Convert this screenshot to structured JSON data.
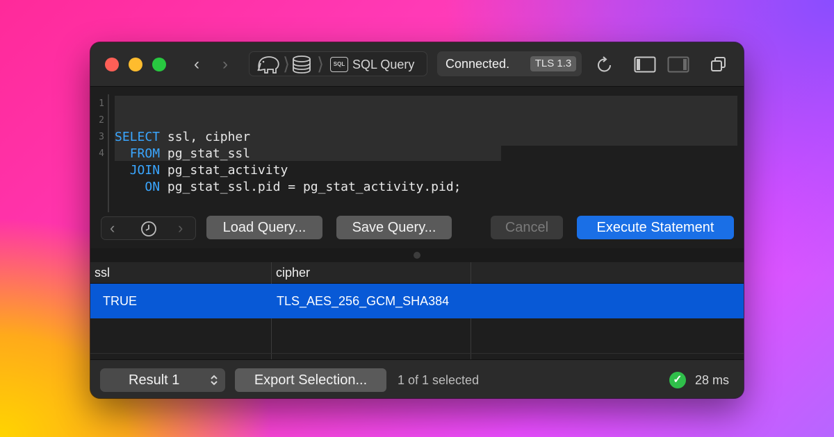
{
  "titlebar": {
    "breadcrumb": {
      "label": "SQL Query",
      "sql_icon_text": "SQL"
    },
    "status": {
      "text": "Connected.",
      "badge": "TLS 1.3"
    },
    "icons": [
      "chevron-left-icon",
      "chevron-right-icon",
      "elephant-icon",
      "database-icon",
      "sql-icon",
      "refresh-icon",
      "sidebar-left-icon",
      "sidebar-right-icon",
      "duplicate-window-icon"
    ]
  },
  "editor": {
    "lines": [
      {
        "num": "1",
        "keyword": "SELECT",
        "rest": " ssl, cipher",
        "indent": ""
      },
      {
        "num": "2",
        "keyword": "FROM",
        "rest": " pg_stat_ssl",
        "indent": "  "
      },
      {
        "num": "3",
        "keyword": "JOIN",
        "rest": " pg_stat_activity",
        "indent": "  "
      },
      {
        "num": "4",
        "keyword": "ON",
        "rest": " pg_stat_ssl.pid = pg_stat_activity.pid;",
        "indent": "    "
      }
    ],
    "colors": {
      "keyword": "#3aa6ff",
      "identifier": "#e8e8e8"
    }
  },
  "toolbar": {
    "load_label": "Load Query...",
    "save_label": "Save Query...",
    "cancel_label": "Cancel",
    "execute_label": "Execute Statement"
  },
  "results": {
    "columns": [
      "ssl",
      "cipher"
    ],
    "rows": [
      [
        "TRUE",
        "TLS_AES_256_GCM_SHA384"
      ]
    ],
    "selection_color": "#0859d6"
  },
  "footer": {
    "result_select": "Result 1",
    "export_label": "Export Selection...",
    "selection_text": "1 of 1 selected",
    "timing": "28 ms"
  },
  "colors": {
    "accent": "#1a6fe6",
    "success": "#2fbf4a"
  }
}
